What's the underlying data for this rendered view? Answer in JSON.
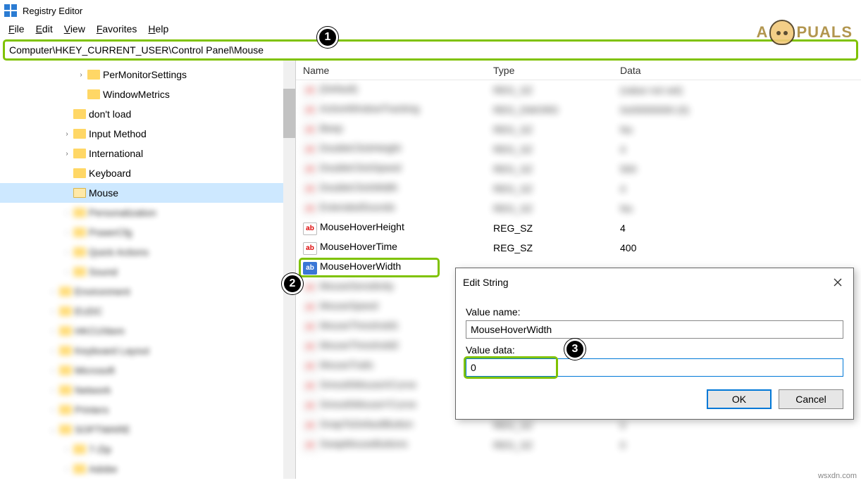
{
  "window": {
    "title": "Registry Editor"
  },
  "menubar": {
    "file": "File",
    "edit": "Edit",
    "view": "View",
    "favorites": "Favorites",
    "help": "Help"
  },
  "addressbar": {
    "path": "Computer\\HKEY_CURRENT_USER\\Control Panel\\Mouse"
  },
  "tree": {
    "items": [
      {
        "label": "PerMonitorSettings",
        "indent": 110,
        "chev": "›",
        "blurred": false
      },
      {
        "label": "WindowMetrics",
        "indent": 110,
        "chev": "",
        "blurred": false
      },
      {
        "label": "don't load",
        "indent": 90,
        "chev": "",
        "blurred": false
      },
      {
        "label": "Input Method",
        "indent": 90,
        "chev": "›",
        "blurred": false
      },
      {
        "label": "International",
        "indent": 90,
        "chev": "›",
        "blurred": false
      },
      {
        "label": "Keyboard",
        "indent": 90,
        "chev": "",
        "blurred": false
      },
      {
        "label": "Mouse",
        "indent": 90,
        "chev": "",
        "blurred": false,
        "selected": true,
        "open": true
      },
      {
        "label": "Personalization",
        "indent": 90,
        "chev": "›",
        "blurred": true
      },
      {
        "label": "PowerCfg",
        "indent": 90,
        "chev": "›",
        "blurred": true
      },
      {
        "label": "Quick Actions",
        "indent": 90,
        "chev": "›",
        "blurred": true
      },
      {
        "label": "Sound",
        "indent": 90,
        "chev": "›",
        "blurred": true
      },
      {
        "label": "Environment",
        "indent": 70,
        "chev": "›",
        "blurred": true
      },
      {
        "label": "EUDC",
        "indent": 70,
        "chev": "›",
        "blurred": true
      },
      {
        "label": "HKCU\\Item",
        "indent": 70,
        "chev": "›",
        "blurred": true
      },
      {
        "label": "Keyboard Layout",
        "indent": 70,
        "chev": "›",
        "blurred": true
      },
      {
        "label": "Microsoft",
        "indent": 70,
        "chev": "›",
        "blurred": true
      },
      {
        "label": "Network",
        "indent": 70,
        "chev": "›",
        "blurred": true
      },
      {
        "label": "Printers",
        "indent": 70,
        "chev": "›",
        "blurred": true
      },
      {
        "label": "SOFTWARE",
        "indent": 70,
        "chev": "⌄",
        "blurred": true
      },
      {
        "label": "7-Zip",
        "indent": 90,
        "chev": "›",
        "blurred": true
      },
      {
        "label": "Adobe",
        "indent": 90,
        "chev": "›",
        "blurred": true
      }
    ]
  },
  "list": {
    "headers": {
      "name": "Name",
      "type": "Type",
      "data": "Data"
    },
    "rows": [
      {
        "name": "(Default)",
        "type": "REG_SZ",
        "data": "(value not set)",
        "blurred": true
      },
      {
        "name": "ActiveWindowTracking",
        "type": "REG_DWORD",
        "data": "0x00000000 (0)",
        "blurred": true
      },
      {
        "name": "Beep",
        "type": "REG_SZ",
        "data": "No",
        "blurred": true
      },
      {
        "name": "DoubleClickHeight",
        "type": "REG_SZ",
        "data": "4",
        "blurred": true
      },
      {
        "name": "DoubleClickSpeed",
        "type": "REG_SZ",
        "data": "500",
        "blurred": true
      },
      {
        "name": "DoubleClickWidth",
        "type": "REG_SZ",
        "data": "4",
        "blurred": true
      },
      {
        "name": "ExtendedSounds",
        "type": "REG_SZ",
        "data": "No",
        "blurred": true
      },
      {
        "name": "MouseHoverHeight",
        "type": "REG_SZ",
        "data": "4",
        "blurred": false
      },
      {
        "name": "MouseHoverTime",
        "type": "REG_SZ",
        "data": "400",
        "blurred": false
      },
      {
        "name": "MouseHoverWidth",
        "type": "",
        "data": "",
        "blurred": false,
        "selected": true,
        "highlight": true
      },
      {
        "name": "MouseSensitivity",
        "type": "",
        "data": "",
        "blurred": true
      },
      {
        "name": "MouseSpeed",
        "type": "",
        "data": "",
        "blurred": true
      },
      {
        "name": "MouseThreshold1",
        "type": "",
        "data": "",
        "blurred": true
      },
      {
        "name": "MouseThreshold2",
        "type": "",
        "data": "",
        "blurred": true
      },
      {
        "name": "MouseTrails",
        "type": "",
        "data": "",
        "blurred": true
      },
      {
        "name": "SmoothMouseXCurve",
        "type": "",
        "data": "",
        "blurred": true
      },
      {
        "name": "SmoothMouseYCurve",
        "type": "",
        "data": "",
        "blurred": true
      },
      {
        "name": "SnapToDefaultButton",
        "type": "REG_SZ",
        "data": "0",
        "blurred": true
      },
      {
        "name": "SwapMouseButtons",
        "type": "REG_SZ",
        "data": "0",
        "blurred": true
      }
    ]
  },
  "dialog": {
    "title": "Edit String",
    "value_name_label": "Value name:",
    "value_name": "MouseHoverWidth",
    "value_data_label": "Value data:",
    "value_data": "0",
    "ok": "OK",
    "cancel": "Cancel"
  },
  "badges": {
    "one": "1",
    "two": "2",
    "three": "3"
  },
  "watermark": {
    "left": "A",
    "right": "PUALS"
  },
  "credit": "wsxdn.com"
}
